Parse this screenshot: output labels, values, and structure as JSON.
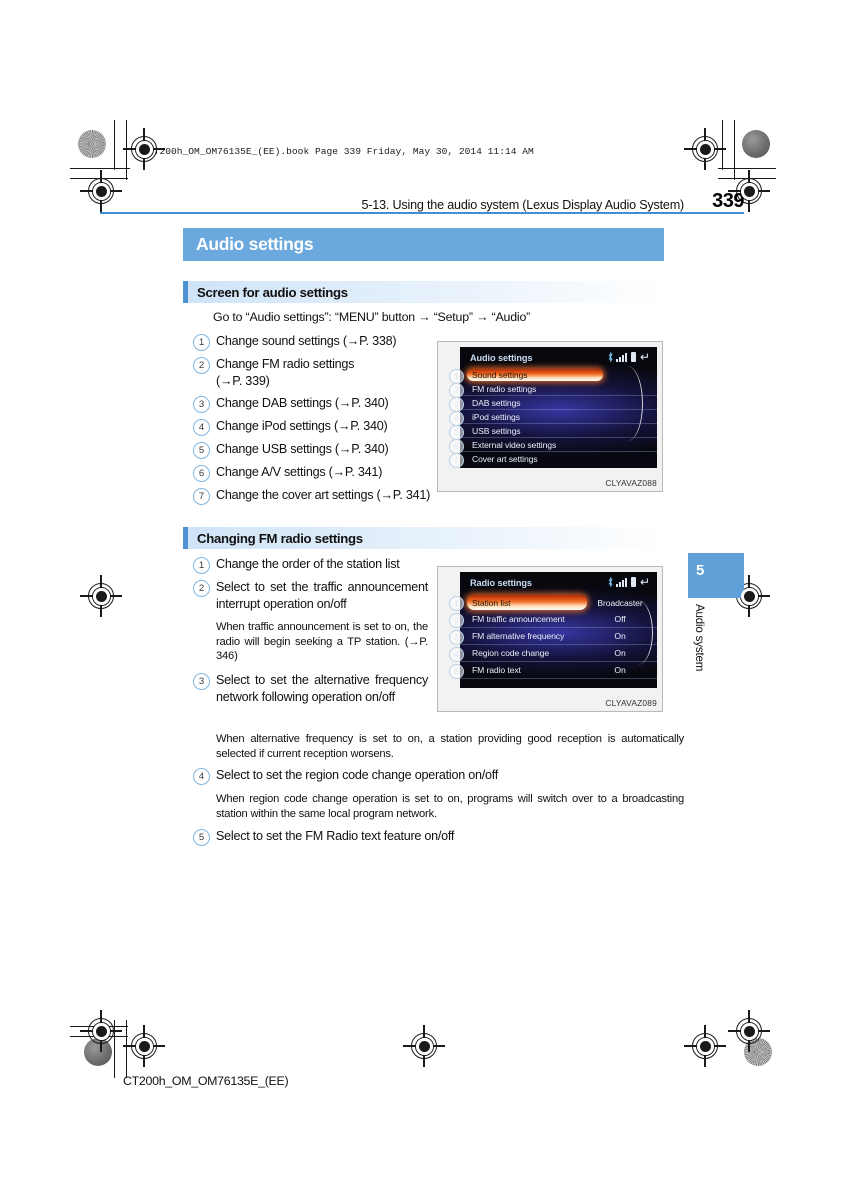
{
  "slug": "CT200h_OM_OM76135E_(EE).book  Page 339  Friday, May 30, 2014  11:14 AM",
  "running_head": {
    "title": "5-13. Using the audio system (Lexus Display Audio System)",
    "page_number": "339"
  },
  "chapter_band": {
    "title": "Audio settings"
  },
  "sections": [
    {
      "heading": "Screen for audio settings",
      "intro": "Go to “Audio settings”: “MENU” button → “Setup” → “Audio”",
      "items": [
        {
          "num": "1",
          "text": "Change sound settings (→P. 338)"
        },
        {
          "num": "2",
          "text": "Change FM radio settings (→P. 339)"
        },
        {
          "num": "3",
          "text": "Change DAB settings (→P. 340)"
        },
        {
          "num": "4",
          "text": "Change iPod settings (→P. 340)"
        },
        {
          "num": "5",
          "text": "Change USB settings (→P. 340)"
        },
        {
          "num": "6",
          "text": "Change A/V settings (→P. 341)"
        },
        {
          "num": "7",
          "text": "Change the cover art settings (→P. 341)"
        }
      ]
    },
    {
      "heading": "Changing FM radio settings",
      "items": [
        {
          "num": "1",
          "text": "Change the order of the station list"
        },
        {
          "num": "2",
          "text": "Select to set the traffic announcement interrupt operation on/off"
        },
        {
          "num": "3",
          "text": "Select to set the alternative frequency network following operation on/off"
        },
        {
          "num": "4",
          "text": "Select to set the region code change operation on/off"
        },
        {
          "num": "5",
          "text": "Select to set the FM Radio text feature on/off"
        }
      ],
      "notes": [
        "When traffic announcement is set to on, the radio will begin seeking a TP station. (→P. 346)",
        "When alternative frequency is set to on, a station providing good reception is automatically selected if current reception worsens.",
        "When region code change operation is set to on, programs will switch over to a broadcasting station within the same local program network."
      ]
    }
  ],
  "figures": [
    {
      "caption": "CLYAVAZ088",
      "screen_title": "Audio settings",
      "status_icons": [
        "bluetooth-icon",
        "signal-icon",
        "battery-icon",
        "back-arrow-icon"
      ],
      "rows": [
        {
          "num": "1",
          "label": "Sound settings",
          "value": "",
          "selected": true
        },
        {
          "num": "2",
          "label": "FM radio settings",
          "value": "",
          "selected": false
        },
        {
          "num": "3",
          "label": "DAB settings",
          "value": "",
          "selected": false
        },
        {
          "num": "4",
          "label": "iPod settings",
          "value": "",
          "selected": false
        },
        {
          "num": "5",
          "label": "USB settings",
          "value": "",
          "selected": false
        },
        {
          "num": "6",
          "label": "External video settings",
          "value": "",
          "selected": false
        },
        {
          "num": "7",
          "label": "Cover art settings",
          "value": "",
          "selected": false
        }
      ]
    },
    {
      "caption": "CLYAVAZ089",
      "screen_title": "Radio settings",
      "status_icons": [
        "bluetooth-icon",
        "signal-icon",
        "battery-icon",
        "back-arrow-icon"
      ],
      "rows": [
        {
          "num": "1",
          "label": "Station list",
          "value": "Broadcaster",
          "selected": true
        },
        {
          "num": "2",
          "label": "FM traffic announcement",
          "value": "Off",
          "selected": false
        },
        {
          "num": "3",
          "label": "FM alternative frequency",
          "value": "On",
          "selected": false
        },
        {
          "num": "4",
          "label": "Region code change",
          "value": "On",
          "selected": false
        },
        {
          "num": "5",
          "label": "FM radio text",
          "value": "On",
          "selected": false
        }
      ]
    }
  ],
  "side_tab": {
    "number": "5",
    "label": "Audio system"
  },
  "footer": "CT200h_OM_OM76135E_(EE)",
  "colors": {
    "accent_blue": "#6aa8de",
    "rule_blue": "#3f8fd4",
    "section_bar": "#4e93d4",
    "highlight_orange": "#f26a22"
  }
}
